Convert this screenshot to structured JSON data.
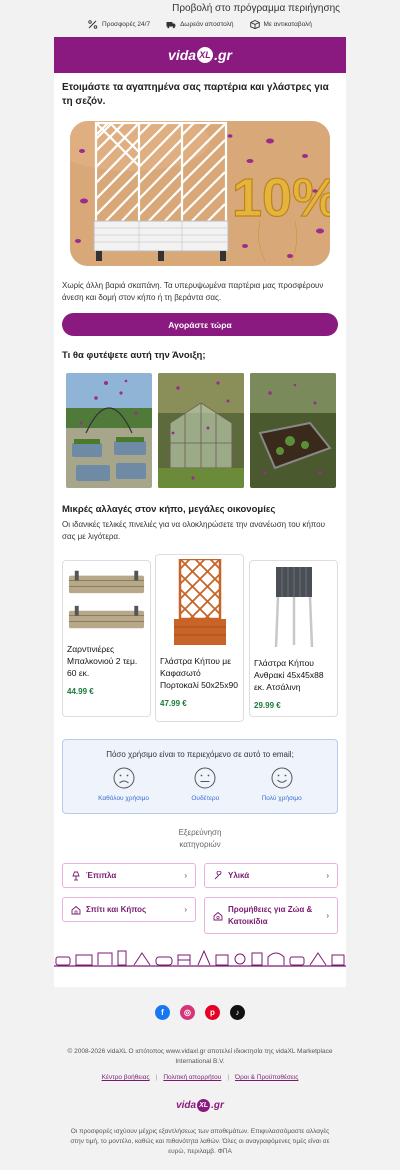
{
  "top": {
    "browser_view": "Προβολή στο πρόγραμμα περιήγησης",
    "usps": [
      {
        "icon": "percent-tag-icon",
        "label": "Προσφορές 24/7"
      },
      {
        "icon": "delivery-truck-icon",
        "label": "Δωρεάν αποστολή"
      },
      {
        "icon": "package-icon",
        "label": "Με αντικαταβολή"
      }
    ]
  },
  "header": {
    "logo_prefix": "vida",
    "logo_mark": "XL",
    "logo_suffix": ".gr"
  },
  "hero": {
    "title": "Ετοιμάστε τα αγαπημένα σας παρτέρια και γλάστρες για τη σεζόν.",
    "badge": "10%",
    "text": "Χωρίς άλλη βαριά σκαπάνη. Τα υπερυψωμένα παρτέρια μας προσφέρουν άνεση και δομή στον κήπο ή τη βεράντα σας.",
    "cta": "Αγοράστε τώρα"
  },
  "plant_section": {
    "title": "Τι θα φυτέψετε αυτή την Άνοιξη;"
  },
  "products_section": {
    "title": "Μικρές αλλαγές στον κήπο, μεγάλες οικονομίες",
    "text": "Οι ιδανικές τελικές πινελιές για να ολοκληρώσετε την ανανέωση του κήπου σας με λιγότερα.",
    "products": [
      {
        "name": "Ζαρντινιέρες Μπαλκονιού 2 τεμ. 60 εκ.",
        "price": "44.99 €"
      },
      {
        "name": "Γλάστρα Κήπου με Καφασωτό Πορτοκαλί 50x25x90",
        "price": "47.99 €"
      },
      {
        "name": "Γλάστρα Κήπου Ανθρακί 45x45x88 εκ. Ατσάλινη",
        "price": "29.99 €"
      }
    ]
  },
  "survey": {
    "question": "Πόσο χρήσιμο είναι το περιεχόμενο σε αυτό το email;",
    "options": [
      "Καθόλου χρήσιμο",
      "Ουδέτερο",
      "Πολύ χρήσιμο"
    ]
  },
  "explore": {
    "title_line1": "Εξερεύνηση",
    "title_line2": "κατηγοριών",
    "categories": [
      {
        "icon": "lamp-icon",
        "label": "Έπιπλα"
      },
      {
        "icon": "wrench-icon",
        "label": "Υλικά"
      },
      {
        "icon": "home-icon",
        "label": "Σπίτι και Κήπος"
      },
      {
        "icon": "pet-house-icon",
        "label": "Προμήθειες για Ζώα & Κατοικίδια"
      }
    ]
  },
  "footer": {
    "social": [
      "facebook-icon",
      "instagram-icon",
      "pinterest-icon",
      "tiktok-icon"
    ],
    "copyright": "© 2008-2026 vidaXL Ο ιστότοπος www.vidaxl.gr αποτελεί ιδιοκτησία της vidaXL Marketplace International B.V.",
    "links": [
      "Κέντρο βοήθειας",
      "Πολιτική απορρήτου",
      "Όροι & Προϋποθέσεις"
    ],
    "disclaimer": "Οι προσφορές ισχύουν μέχρις εξαντλήσεως των αποθεμάτων. Επιφυλασσόμαστε αλλαγές στην τιμή, το μοντέλο, καθώς και πιθανότητα λαθών. Όλες οι αναγραφόμενες τιμές είναι σε ευρώ, περιλαμβ. ΦΠΑ"
  },
  "colors": {
    "brand": "#8b1a80",
    "price": "#1a7a3a",
    "link": "#3b6fd0"
  }
}
